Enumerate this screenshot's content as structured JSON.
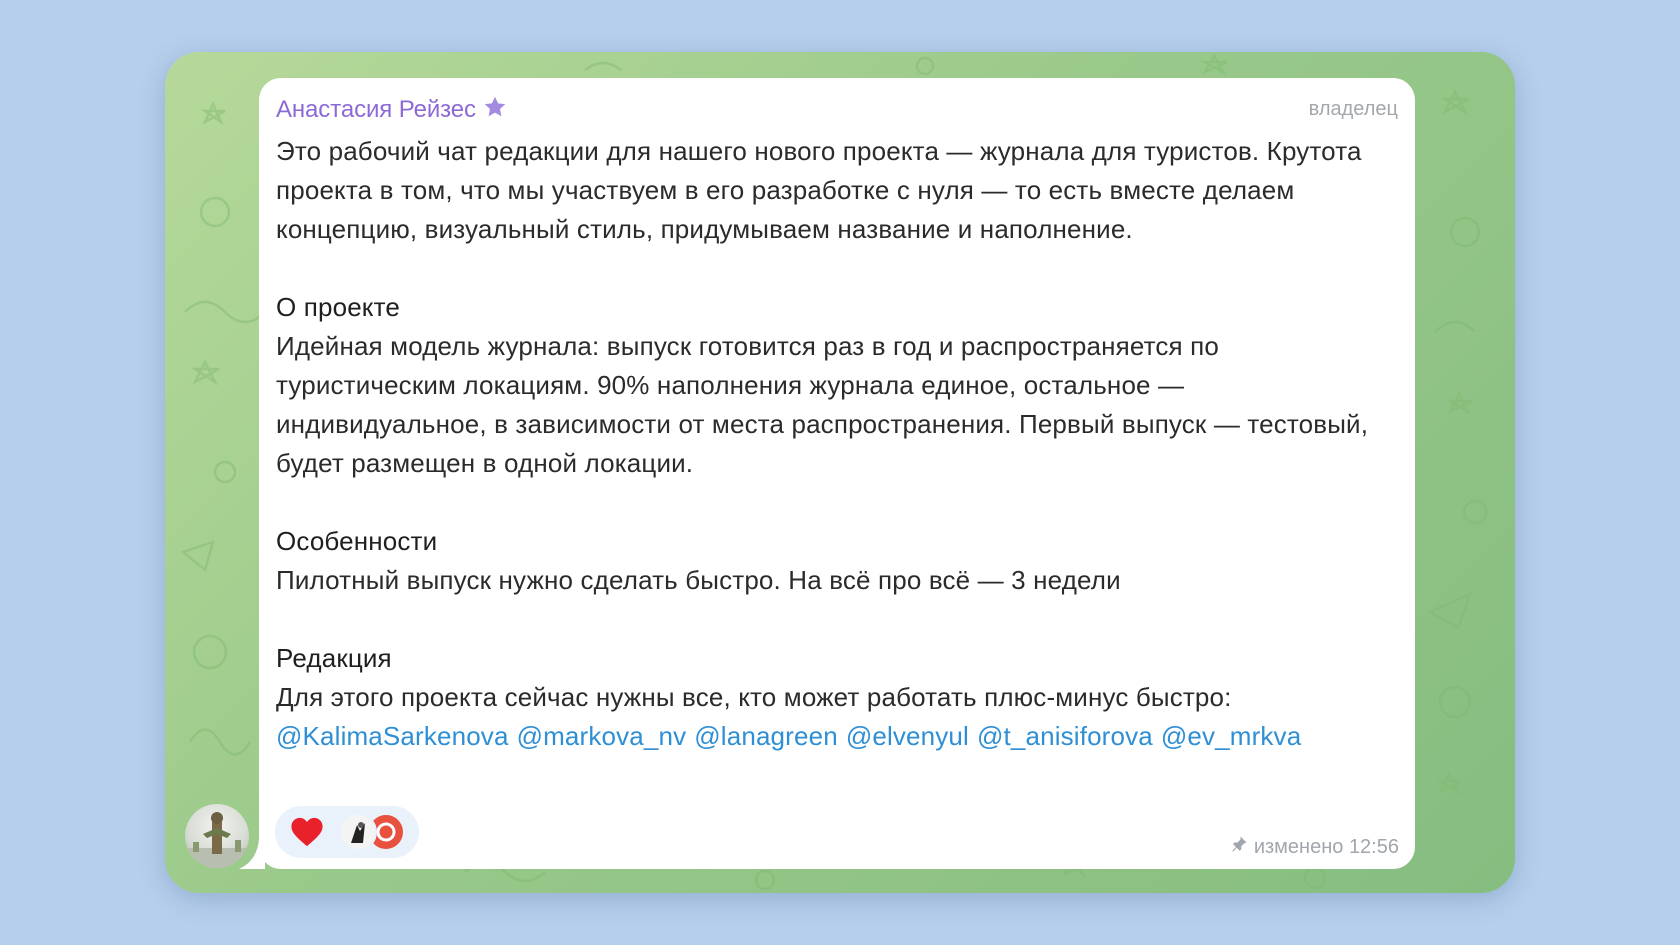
{
  "message": {
    "sender_name": "Анастасия Рейзес",
    "sender_badge_icon": "star-icon",
    "role": "владелец",
    "paragraphs": {
      "intro": "Это рабочий чат редакции для нашего нового проекта — журнала для туристов. Крутота проекта в том, что мы участвуем в его разработке с нуля — то есть вместе делаем концепцию, визуальный стиль, придумываем название и наполнение.",
      "about_title": "О проекте",
      "about_text": "Идейная модель журнала: выпуск готовится раз в год и распространяется по туристическим локациям. 90% наполнения журнала единое, остальное — индивидуальное, в зависимости от места распространения. Первый выпуск — тестовый, будет размещен в одной локации.",
      "features_title": "Особенности",
      "features_text": "Пилотный выпуск нужно сделать быстро. На всё про всё — 3 недели",
      "team_title": "Редакция",
      "team_text": "Для этого проекта сейчас нужны все, кто может работать плюс-минус быстро:"
    },
    "mentions": [
      "@KalimaSarkenova",
      "@markova_nv",
      "@lanagreen",
      "@elvenyul",
      "@t_anisiforova",
      "@ev_mrkva"
    ],
    "reactions": {
      "emoji": "heart-icon",
      "reactor_count": 2
    },
    "footer": {
      "pin_icon": "pin-icon",
      "status": "изменено",
      "time": "12:56"
    }
  },
  "colors": {
    "sender": "#8c6ad6",
    "mention": "#2f8fd4",
    "background": "#b6cfec",
    "chat_wallpaper": "#a3cf8f"
  }
}
